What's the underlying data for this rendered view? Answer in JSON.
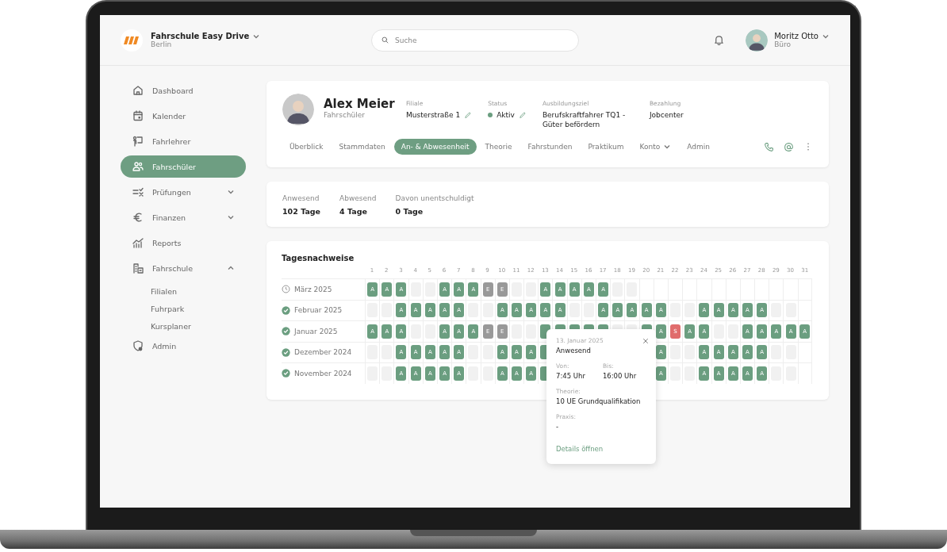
{
  "brand": {
    "name": "Fahrschule Easy Drive",
    "location": "Berlin"
  },
  "search": {
    "placeholder": "Suche"
  },
  "user": {
    "name": "Moritz Otto",
    "role": "Büro"
  },
  "sidebar": {
    "items": [
      {
        "label": "Dashboard",
        "selected": false
      },
      {
        "label": "Kalender",
        "selected": false
      },
      {
        "label": "Fahrlehrer",
        "selected": false
      },
      {
        "label": "Fahrschüler",
        "selected": true
      },
      {
        "label": "Prüfungen",
        "selected": false,
        "expanded": false
      },
      {
        "label": "Finanzen",
        "selected": false,
        "expanded": false
      },
      {
        "label": "Reports",
        "selected": false
      },
      {
        "label": "Fahrschule",
        "selected": false,
        "expanded": true,
        "children": [
          {
            "label": "Filialen",
            "selected": false
          },
          {
            "label": "Fuhrpark",
            "selected": false
          },
          {
            "label": "Kursplaner",
            "selected": false
          }
        ]
      },
      {
        "label": "Admin",
        "selected": false
      }
    ]
  },
  "profile": {
    "name": "Alex Meier",
    "role": "Fahrschüler",
    "fields": [
      {
        "kind": "text",
        "label": "Filiale",
        "value": "Musterstraße 1",
        "editable": true
      },
      {
        "kind": "status",
        "label": "Status",
        "value": "Aktiv",
        "editable": true,
        "color": "#6b9e80"
      },
      {
        "kind": "text",
        "label": "Ausbildungsziel",
        "value": "Berufskraftfahrer TQ1 - Güter befördern",
        "editable": false
      },
      {
        "kind": "text",
        "label": "Bezahlung",
        "value": "Jobcenter",
        "editable": false
      }
    ]
  },
  "tabs": [
    {
      "label": "Überblick",
      "selected": false
    },
    {
      "label": "Stammdaten",
      "selected": false
    },
    {
      "label": "An- & Abwesenheit",
      "selected": true
    },
    {
      "label": "Theorie",
      "selected": false
    },
    {
      "label": "Fahrstunden",
      "selected": false
    },
    {
      "label": "Praktikum",
      "selected": false
    },
    {
      "label": "Konto",
      "selected": false,
      "dropdown": true
    },
    {
      "label": "Admin",
      "selected": false
    }
  ],
  "summary": [
    {
      "label": "Anwesend",
      "value": "102 Tage"
    },
    {
      "label": "Abwesend",
      "value": "4 Tage"
    },
    {
      "label": "Davon unentschuldigt",
      "value": "0 Tage"
    }
  ],
  "attendance": {
    "title": "Tagesnachweise",
    "days": [
      "1",
      "2",
      "3",
      "4",
      "5",
      "6",
      "7",
      "8",
      "9",
      "10",
      "11",
      "12",
      "13",
      "14",
      "15",
      "16",
      "17",
      "18",
      "19",
      "20",
      "21",
      "22",
      "23",
      "24",
      "25",
      "26",
      "27",
      "28",
      "29",
      "30",
      "31"
    ],
    "months": [
      {
        "label": "März 2025",
        "completed": false,
        "cells": [
          {
            "kind": "present",
            "label": "A"
          },
          {
            "kind": "present",
            "label": "A"
          },
          {
            "kind": "present",
            "label": "A"
          },
          {
            "kind": "empty"
          },
          {
            "kind": "empty"
          },
          {
            "kind": "present",
            "label": "A"
          },
          {
            "kind": "present",
            "label": "A"
          },
          {
            "kind": "present",
            "label": "A"
          },
          {
            "kind": "excused",
            "label": "E"
          },
          {
            "kind": "excused",
            "label": "E"
          },
          {
            "kind": "empty"
          },
          {
            "kind": "empty"
          },
          {
            "kind": "present",
            "label": "A"
          },
          {
            "kind": "present",
            "label": "A"
          },
          {
            "kind": "present",
            "label": "A"
          },
          {
            "kind": "present",
            "label": "A"
          },
          {
            "kind": "present",
            "label": "A"
          },
          {
            "kind": "empty"
          },
          {
            "kind": "empty"
          },
          {
            "kind": "none"
          },
          {
            "kind": "none"
          },
          {
            "kind": "none"
          },
          {
            "kind": "none"
          },
          {
            "kind": "none"
          },
          {
            "kind": "none"
          },
          {
            "kind": "none"
          },
          {
            "kind": "none"
          },
          {
            "kind": "none"
          },
          {
            "kind": "none"
          },
          {
            "kind": "none"
          },
          {
            "kind": "none"
          }
        ]
      },
      {
        "label": "Februar 2025",
        "completed": true,
        "cells": [
          {
            "kind": "empty"
          },
          {
            "kind": "empty"
          },
          {
            "kind": "present",
            "label": "A"
          },
          {
            "kind": "present",
            "label": "A"
          },
          {
            "kind": "present",
            "label": "A"
          },
          {
            "kind": "present",
            "label": "A"
          },
          {
            "kind": "present",
            "label": "A"
          },
          {
            "kind": "empty"
          },
          {
            "kind": "empty"
          },
          {
            "kind": "present",
            "label": "A"
          },
          {
            "kind": "present",
            "label": "A"
          },
          {
            "kind": "present",
            "label": "A"
          },
          {
            "kind": "present",
            "label": "A"
          },
          {
            "kind": "present",
            "label": "A"
          },
          {
            "kind": "empty"
          },
          {
            "kind": "empty"
          },
          {
            "kind": "present",
            "label": "A"
          },
          {
            "kind": "present",
            "label": "A"
          },
          {
            "kind": "present",
            "label": "A"
          },
          {
            "kind": "present",
            "label": "A"
          },
          {
            "kind": "present",
            "label": "A"
          },
          {
            "kind": "empty"
          },
          {
            "kind": "empty"
          },
          {
            "kind": "present",
            "label": "A"
          },
          {
            "kind": "present",
            "label": "A"
          },
          {
            "kind": "present",
            "label": "A"
          },
          {
            "kind": "present",
            "label": "A"
          },
          {
            "kind": "present",
            "label": "A"
          },
          {
            "kind": "empty"
          },
          {
            "kind": "empty"
          },
          {
            "kind": "none"
          }
        ]
      },
      {
        "label": "Januar 2025",
        "completed": true,
        "cells": [
          {
            "kind": "present",
            "label": "A"
          },
          {
            "kind": "present",
            "label": "A"
          },
          {
            "kind": "present",
            "label": "A"
          },
          {
            "kind": "empty"
          },
          {
            "kind": "empty"
          },
          {
            "kind": "present",
            "label": "A"
          },
          {
            "kind": "present",
            "label": "A"
          },
          {
            "kind": "present",
            "label": "A"
          },
          {
            "kind": "excused",
            "label": "E"
          },
          {
            "kind": "excused",
            "label": "E"
          },
          {
            "kind": "empty"
          },
          {
            "kind": "empty"
          },
          {
            "kind": "present"
          },
          {
            "kind": "present"
          },
          {
            "kind": "present"
          },
          {
            "kind": "present"
          },
          {
            "kind": "present"
          },
          {
            "kind": "empty"
          },
          {
            "kind": "empty"
          },
          {
            "kind": "present"
          },
          {
            "kind": "present",
            "label": "A"
          },
          {
            "kind": "sick",
            "label": "S"
          },
          {
            "kind": "present",
            "label": "A"
          },
          {
            "kind": "present",
            "label": "A"
          },
          {
            "kind": "empty"
          },
          {
            "kind": "empty"
          },
          {
            "kind": "present",
            "label": "A"
          },
          {
            "kind": "present",
            "label": "A"
          },
          {
            "kind": "present",
            "label": "A"
          },
          {
            "kind": "present",
            "label": "A"
          },
          {
            "kind": "present",
            "label": "A"
          }
        ]
      },
      {
        "label": "Dezember 2024",
        "completed": true,
        "cells": [
          {
            "kind": "empty"
          },
          {
            "kind": "empty"
          },
          {
            "kind": "present",
            "label": "A"
          },
          {
            "kind": "present",
            "label": "A"
          },
          {
            "kind": "present",
            "label": "A"
          },
          {
            "kind": "present",
            "label": "A"
          },
          {
            "kind": "present",
            "label": "A"
          },
          {
            "kind": "empty"
          },
          {
            "kind": "empty"
          },
          {
            "kind": "present",
            "label": "A"
          },
          {
            "kind": "present",
            "label": "A"
          },
          {
            "kind": "present",
            "label": "A"
          },
          {
            "kind": "present"
          },
          {
            "kind": "covered"
          },
          {
            "kind": "covered"
          },
          {
            "kind": "covered"
          },
          {
            "kind": "covered"
          },
          {
            "kind": "covered"
          },
          {
            "kind": "covered"
          },
          {
            "kind": "covered"
          },
          {
            "kind": "present",
            "label": "A"
          },
          {
            "kind": "empty"
          },
          {
            "kind": "empty"
          },
          {
            "kind": "present",
            "label": "A"
          },
          {
            "kind": "present",
            "label": "A"
          },
          {
            "kind": "present",
            "label": "A"
          },
          {
            "kind": "present",
            "label": "A"
          },
          {
            "kind": "present",
            "label": "A"
          },
          {
            "kind": "empty"
          },
          {
            "kind": "empty"
          },
          {
            "kind": "none"
          }
        ]
      },
      {
        "label": "November 2024",
        "completed": true,
        "cells": [
          {
            "kind": "empty"
          },
          {
            "kind": "empty"
          },
          {
            "kind": "present",
            "label": "A"
          },
          {
            "kind": "present",
            "label": "A"
          },
          {
            "kind": "present",
            "label": "A"
          },
          {
            "kind": "present",
            "label": "A"
          },
          {
            "kind": "present",
            "label": "A"
          },
          {
            "kind": "empty"
          },
          {
            "kind": "empty"
          },
          {
            "kind": "present",
            "label": "A"
          },
          {
            "kind": "present",
            "label": "A"
          },
          {
            "kind": "present",
            "label": "A"
          },
          {
            "kind": "present"
          },
          {
            "kind": "covered"
          },
          {
            "kind": "covered"
          },
          {
            "kind": "covered"
          },
          {
            "kind": "covered"
          },
          {
            "kind": "covered"
          },
          {
            "kind": "covered"
          },
          {
            "kind": "covered"
          },
          {
            "kind": "present",
            "label": "A"
          },
          {
            "kind": "empty"
          },
          {
            "kind": "empty"
          },
          {
            "kind": "present",
            "label": "A"
          },
          {
            "kind": "present",
            "label": "A"
          },
          {
            "kind": "present",
            "label": "A"
          },
          {
            "kind": "present",
            "label": "A"
          },
          {
            "kind": "present",
            "label": "A"
          },
          {
            "kind": "empty"
          },
          {
            "kind": "empty"
          },
          {
            "kind": "none"
          }
        ]
      }
    ]
  },
  "popover": {
    "date": "13. Januar 2025",
    "status": "Anwesend",
    "from_label": "Von:",
    "from": "7:45 Uhr",
    "to_label": "Bis:",
    "to": "16:00 Uhr",
    "theory_label": "Theorie:",
    "theory": "10 UE Grundqualifikation",
    "practice_label": "Praxis:",
    "practice": "-",
    "link": "Details öffnen"
  }
}
